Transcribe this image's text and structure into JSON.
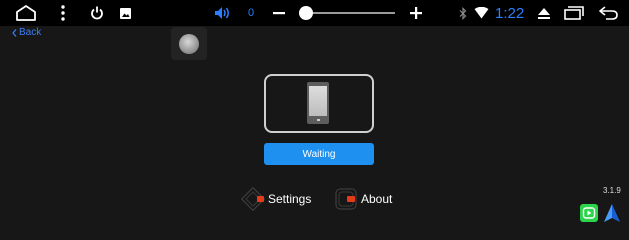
{
  "statusbar": {
    "icons": {
      "home": "home-icon",
      "menu": "more-vertical-icon",
      "power": "power-icon",
      "gallery": "image-icon",
      "volume": "volume-icon",
      "minus": "volume-down-icon",
      "plus": "volume-up-icon",
      "bluetooth": "bluetooth-icon",
      "wifi": "wifi-icon",
      "eject": "eject-icon",
      "recents": "recent-apps-icon",
      "back": "back-arrow-icon"
    },
    "volume_value": "0",
    "volume_level": 0.0,
    "clock": "1:22",
    "accent_color": "#2a7fff"
  },
  "nav": {
    "back_label": "Back"
  },
  "connect": {
    "status_button": "Waiting"
  },
  "footer": {
    "settings_label": "Settings",
    "about_label": "About"
  },
  "version": "3.1.9",
  "apps": {
    "carplay_icon": "carplay-icon",
    "android_auto_icon": "android-auto-icon"
  }
}
